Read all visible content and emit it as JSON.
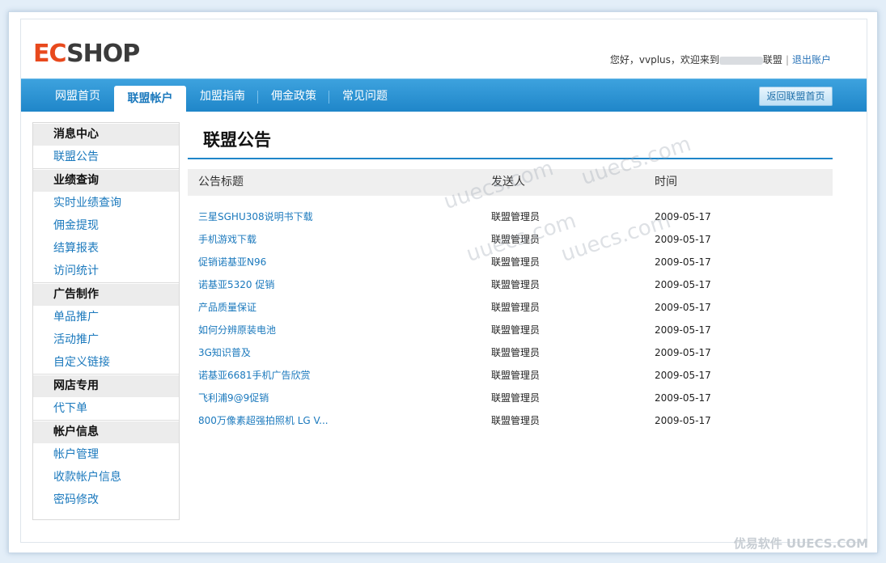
{
  "header": {
    "logo_ec": "EC",
    "logo_shop": "SHOP",
    "greeting": "您好，vvplus，欢迎来到",
    "greeting_suffix": "联盟",
    "logout": "退出账户"
  },
  "nav": {
    "items": [
      "网盟首页",
      "联盟帐户",
      "加盟指南",
      "佣金政策",
      "常见问题"
    ],
    "active_index": 1,
    "return_button": "返回联盟首页"
  },
  "sidebar": [
    {
      "heading": "消息中心",
      "links": [
        "联盟公告"
      ]
    },
    {
      "heading": "业绩查询",
      "links": [
        "实时业绩查询",
        "佣金提现",
        "结算报表",
        "访问统计"
      ]
    },
    {
      "heading": "广告制作",
      "links": [
        "单品推广",
        "活动推广",
        "自定义链接"
      ]
    },
    {
      "heading": "网店专用",
      "links": [
        "代下单"
      ]
    },
    {
      "heading": "帐户信息",
      "links": [
        "帐户管理",
        "收款帐户信息",
        "密码修改"
      ]
    }
  ],
  "main": {
    "title": "联盟公告",
    "columns": [
      "公告标题",
      "发送人",
      "时间"
    ],
    "rows": [
      {
        "title": "三星SGHU308说明书下载",
        "sender": "联盟管理员",
        "time": "2009-05-17"
      },
      {
        "title": "手机游戏下载",
        "sender": "联盟管理员",
        "time": "2009-05-17"
      },
      {
        "title": "促销诺基亚N96",
        "sender": "联盟管理员",
        "time": "2009-05-17"
      },
      {
        "title": "诺基亚5320 促销",
        "sender": "联盟管理员",
        "time": "2009-05-17"
      },
      {
        "title": "产品质量保证",
        "sender": "联盟管理员",
        "time": "2009-05-17"
      },
      {
        "title": "如何分辨原装电池",
        "sender": "联盟管理员",
        "time": "2009-05-17"
      },
      {
        "title": "3G知识普及",
        "sender": "联盟管理员",
        "time": "2009-05-17"
      },
      {
        "title": "诺基亚6681手机广告欣赏",
        "sender": "联盟管理员",
        "time": "2009-05-17"
      },
      {
        "title": "飞利浦9@9促销",
        "sender": "联盟管理员",
        "time": "2009-05-17"
      },
      {
        "title": "800万像素超强拍照机 LG V...",
        "sender": "联盟管理员",
        "time": "2009-05-17"
      }
    ]
  },
  "watermarks": [
    "uuecs.com",
    "uuecs.com",
    "uuecs.com",
    "uuecs.com"
  ],
  "footer_brand": "优易软件 UUECS.COM"
}
